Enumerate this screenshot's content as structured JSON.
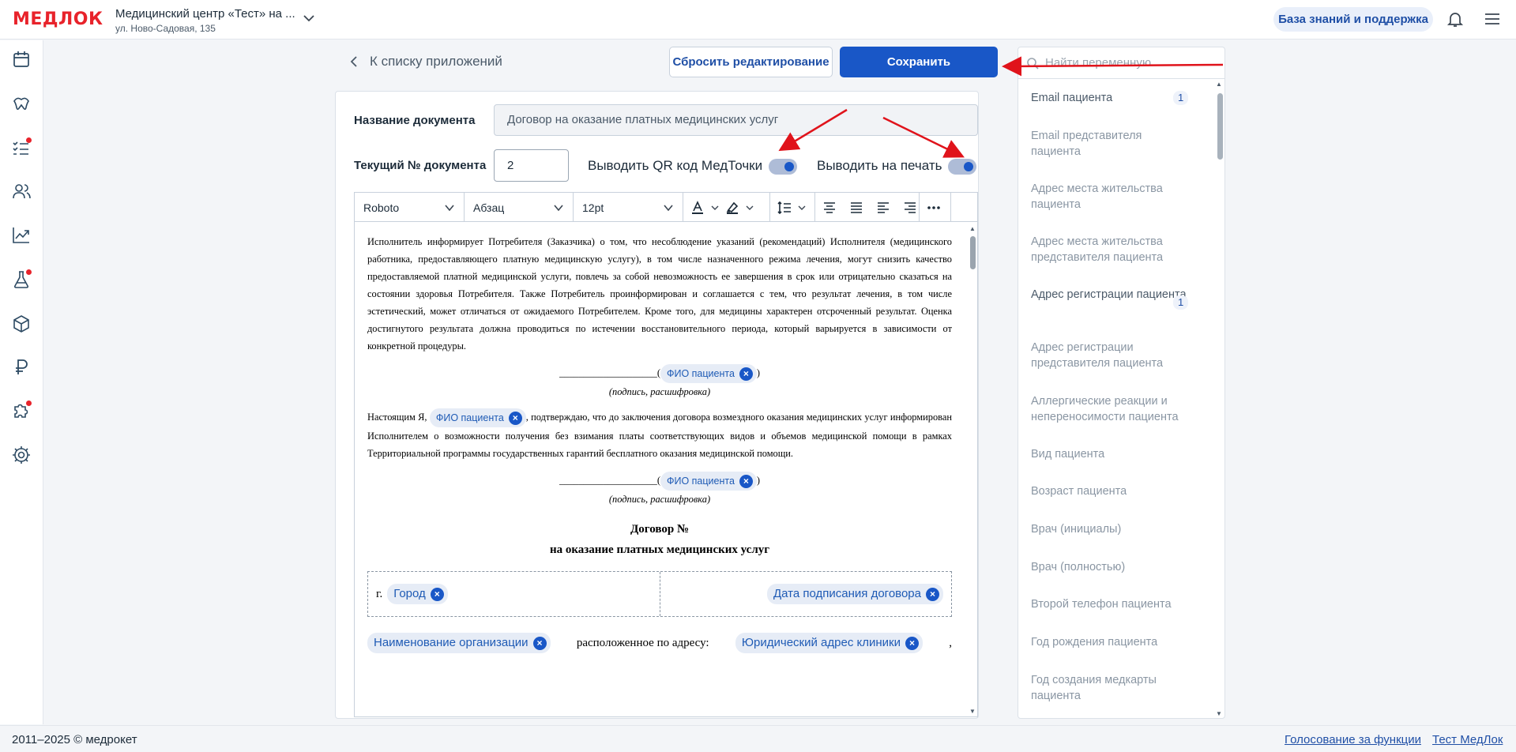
{
  "header": {
    "logo": "МЕДЛОК",
    "clinic_name": "Медицинский центр «Тест» на ...",
    "clinic_address": "ул. Ново-Садовая, 135",
    "kb_button": "База знаний и поддержка"
  },
  "toolbar": {
    "back_label": "К списку приложений",
    "reset_label": "Сбросить редактирование",
    "save_label": "Сохранить"
  },
  "form": {
    "doc_name_label": "Название документа",
    "doc_name_value": "Договор на оказание платных медицинских услуг",
    "doc_number_label": "Текущий № документа",
    "doc_number_value": "2",
    "qr_toggle_label": "Выводить QR код МедТочки",
    "qr_toggle_on": true,
    "print_toggle_label": "Выводить на печать",
    "print_toggle_on": true
  },
  "editor": {
    "font": "Roboto",
    "block": "Абзац",
    "size": "12pt"
  },
  "document": {
    "para1": "Исполнитель информирует Потребителя (Заказчика) о том, что несоблюдение указаний (рекомендаций) Исполнителя (медицинского работника, предоставляющего платную медицинскую услугу), в том числе назначенного режима лечения, могут снизить качество предоставляемой платной медицинской услуги, повлечь за собой невозможность ее завершения в срок или отрицательно сказаться на состоянии здоровья Потребителя. Также Потребитель проинформирован и соглашается с тем, что результат лечения, в том числе эстетический, может отличаться от ожидаемого Потребителем. Кроме того, для медицины характерен отсроченный результат. Оценка достигнутого результата должна проводиться по истечении восстановительного периода, который варьируется в зависимости от конкретной процедуры.",
    "sign_line": "____________________(",
    "sign_close": ")",
    "sign_caption": "(подпись, расшифровка)",
    "chip_patient": "ФИО пациента",
    "para2_start": "Настоящим Я,",
    "para2_rest": ", подтверждаю, что до заключения договора возмездного оказания медицинских услуг информирован Исполнителем о возможности получения без взимания платы соответствующих видов и объемов медицинской помощи в рамках Территориальной программы государственных гарантий бесплатного оказания медицинской помощи.",
    "title_line1": "Договор №",
    "title_line2": "на оказание платных медицинских услуг",
    "city_prefix": "г.",
    "chip_city": "Город",
    "chip_date": "Дата подписания договора",
    "chip_org": "Наименование организации",
    "located_text": "расположенное по адресу:",
    "chip_address": "Юридический адрес клиники",
    "comma": ","
  },
  "variables": {
    "search_placeholder": "Найти переменную",
    "items": [
      {
        "label": "Email пациента",
        "count": "1"
      },
      {
        "label": "Email представителя пациента"
      },
      {
        "label": "Адрес места жительства пациента"
      },
      {
        "label": "Адрес места жительства представителя пациента"
      },
      {
        "label": "Адрес регистрации пациента",
        "count": "1"
      },
      {
        "label": "Адрес регистрации представителя пациента"
      },
      {
        "label": "Аллергические реакции и непереносимости пациента"
      },
      {
        "label": "Вид пациента"
      },
      {
        "label": "Возраст пациента"
      },
      {
        "label": "Врач (инициалы)"
      },
      {
        "label": "Врач (полностью)"
      },
      {
        "label": "Второй телефон пациента"
      },
      {
        "label": "Год рождения пациента"
      },
      {
        "label": "Год создания медкарты пациента"
      }
    ]
  },
  "footer": {
    "copyright": "2011–2025 © медрокет",
    "link_vote": "Голосование за функции",
    "link_test": "Тест МедЛок"
  },
  "colors": {
    "brand_red": "#e8232b",
    "primary_blue": "#1957c7",
    "annotation_red": "#e0131b"
  }
}
